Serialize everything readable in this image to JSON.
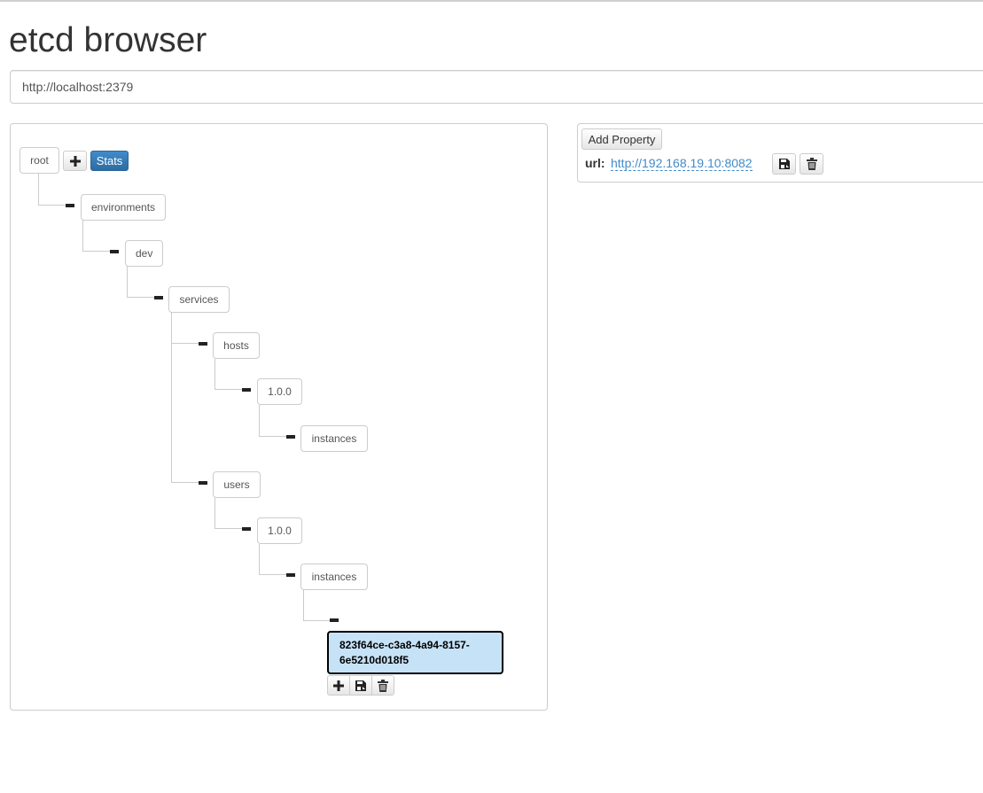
{
  "app": {
    "title": "etcd browser"
  },
  "server": {
    "url": "http://localhost:2379"
  },
  "toolbar": {
    "add_icon": "plus-icon",
    "stats_label": "Stats"
  },
  "tree": {
    "root": "root",
    "environments": "environments",
    "dev": "dev",
    "services": "services",
    "hosts": "hosts",
    "hosts_version": "1.0.0",
    "hosts_instances": "instances",
    "users": "users",
    "users_version": "1.0.0",
    "users_instances": "instances",
    "selected_key": "823f64ce-c3a8-4a94-8157-6e5210d018f5"
  },
  "node_actions": {
    "icons": [
      "plus-icon",
      "save-icon",
      "trash-icon"
    ]
  },
  "properties": {
    "add_label": "Add Property",
    "items": [
      {
        "key": "url:",
        "value": "http://192.168.19.10:8082"
      }
    ]
  },
  "colors": {
    "accent": "#428bca",
    "selected_bg": "#c6e2f7",
    "border": "#cccccc"
  }
}
